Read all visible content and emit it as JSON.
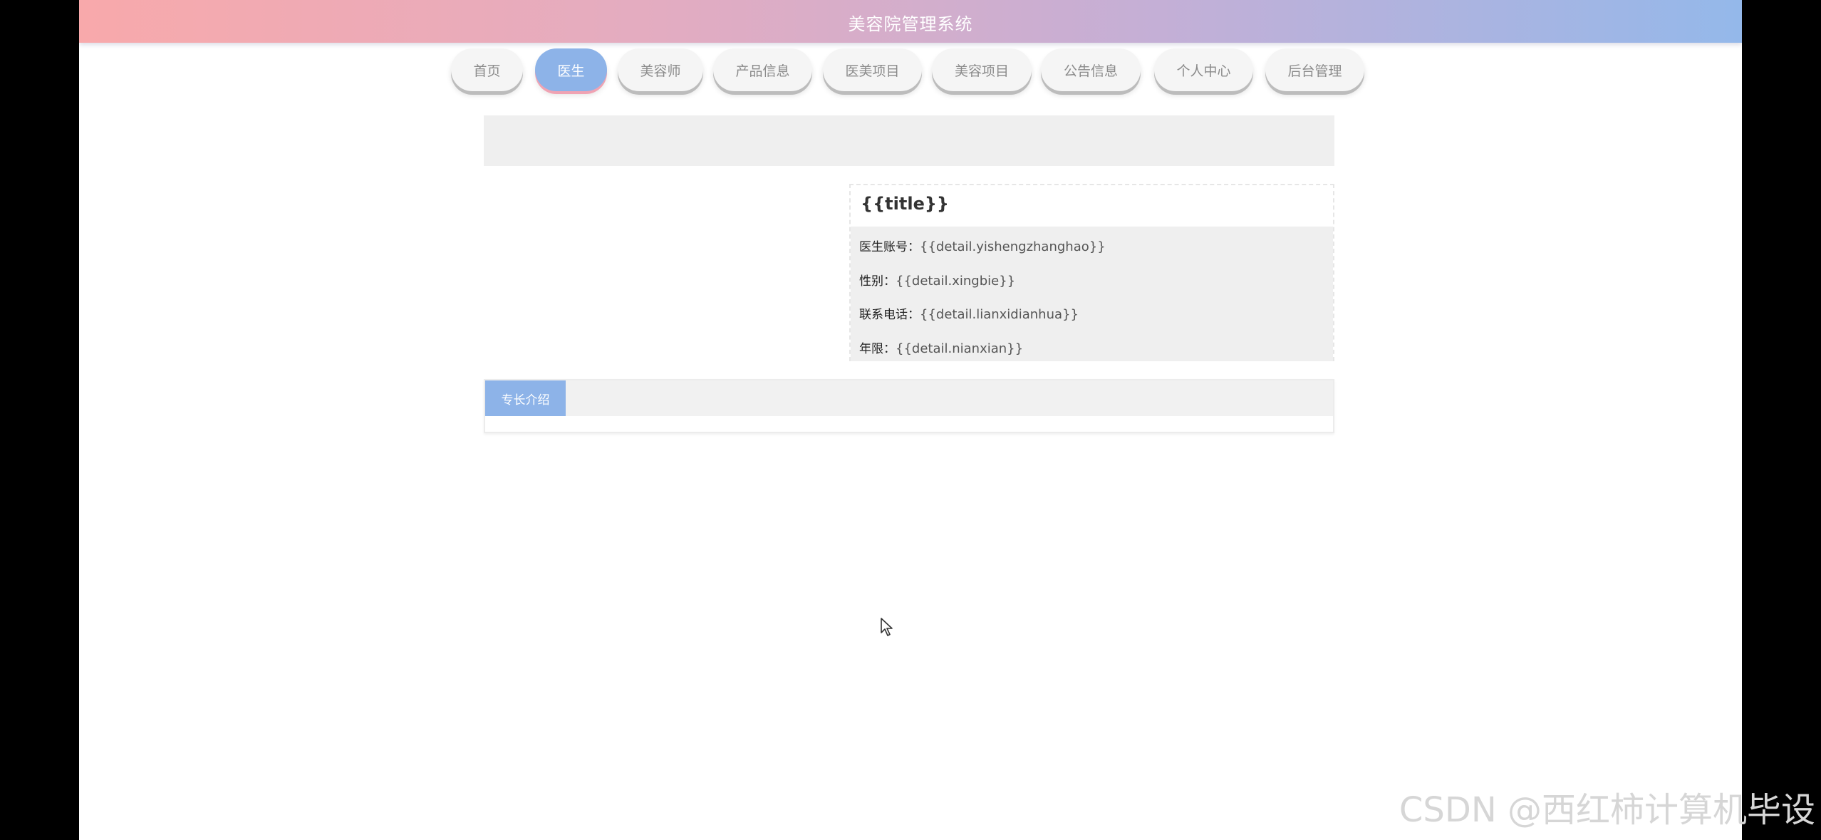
{
  "header": {
    "title": "美容院管理系统"
  },
  "nav": {
    "items": [
      {
        "label": "首页",
        "active": false
      },
      {
        "label": "医生",
        "active": true
      },
      {
        "label": "美容师",
        "active": false
      },
      {
        "label": "产品信息",
        "active": false
      },
      {
        "label": "医美项目",
        "active": false
      },
      {
        "label": "美容项目",
        "active": false
      },
      {
        "label": "公告信息",
        "active": false
      },
      {
        "label": "个人中心",
        "active": false
      },
      {
        "label": "后台管理",
        "active": false
      }
    ]
  },
  "detail": {
    "title": "{{title}}",
    "fields": [
      {
        "label": "医生账号：",
        "value": "{{detail.yishengzhanghao}}"
      },
      {
        "label": "性别：",
        "value": "{{detail.xingbie}}"
      },
      {
        "label": "联系电话：",
        "value": "{{detail.lianxidianhua}}"
      },
      {
        "label": "年限：",
        "value": "{{detail.nianxian}}"
      }
    ]
  },
  "tabs": {
    "active_label": "专长介绍"
  },
  "watermark": "CSDN @西红柿计算机毕设",
  "colors": {
    "accent": "#8db3e8",
    "header_gradient_start": "#f8a9ab",
    "header_gradient_end": "#94b8ea",
    "panel_gray": "#efefef"
  }
}
